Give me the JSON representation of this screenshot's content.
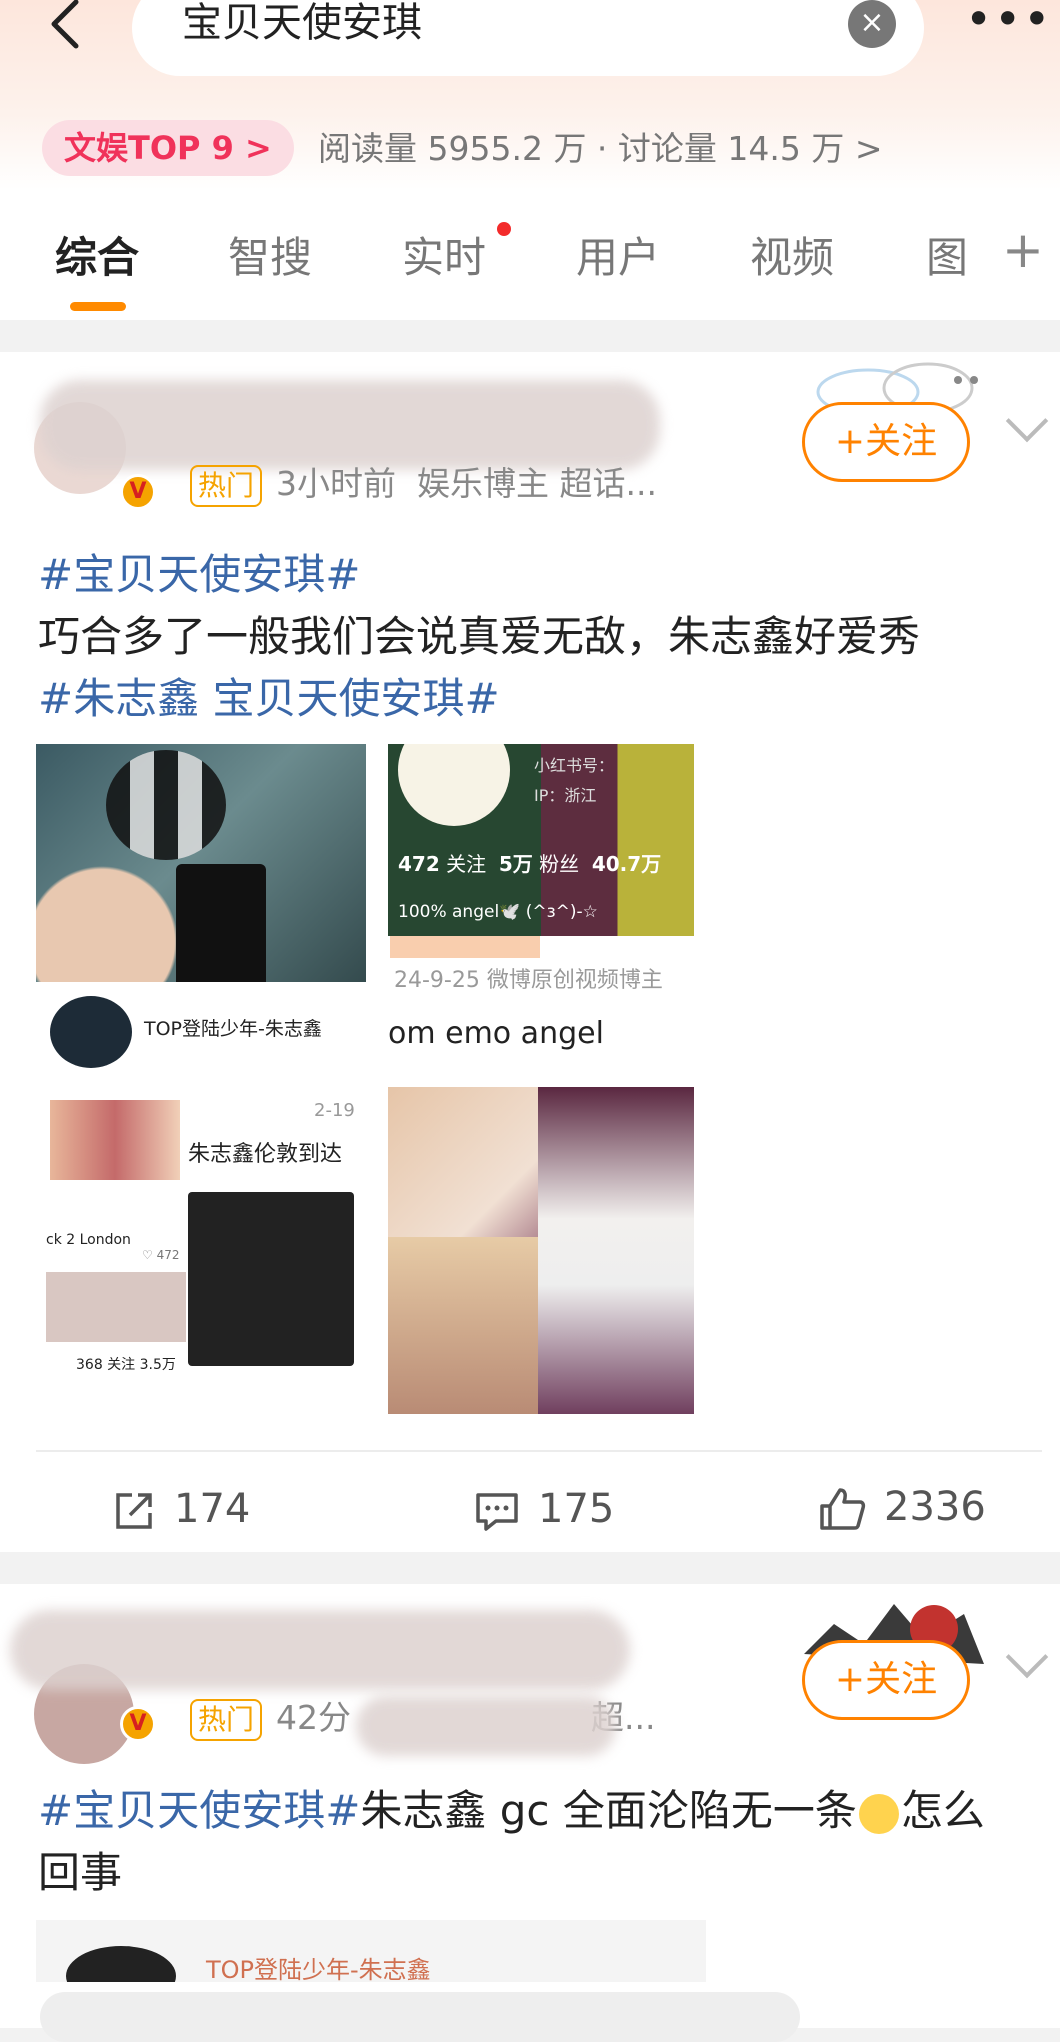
{
  "search": {
    "query": "宝贝天使安琪"
  },
  "topic": {
    "rank_badge": "文娱TOP 9 >",
    "stats": "阅读量 5955.2 万 · 讨论量 14.5 万 >"
  },
  "tabs": [
    {
      "label": "综合"
    },
    {
      "label": "智搜"
    },
    {
      "label": "实时"
    },
    {
      "label": "用户"
    },
    {
      "label": "视频"
    },
    {
      "label": "图"
    }
  ],
  "posts": [
    {
      "time": "3小时前",
      "source": "娱乐博主 超话...",
      "hot_label": "热门",
      "follow": "+关注",
      "tag1": "#宝贝天使安琪#",
      "text": "巧合多了一般我们会说真爱无敌，朱志鑫好爱秀",
      "tag2": "#朱志鑫 宝贝天使安琪#",
      "img1_caption": "TOP登陆少年-朱志鑫",
      "img2_stats": {
        "follow": "472",
        "follow_label": "关注",
        "fans": "5万",
        "fans_label": "粉丝",
        "likes": "40.7万"
      },
      "img2_xhs": "小红书号：",
      "img2_ip": "IP：浙江",
      "img2_bio": "100% angel🕊️ (^з^)-☆",
      "img2_date": "24-9-25  微博原创视频博主",
      "img2_line": "om emo angel",
      "img3_date": "2-19",
      "img3_title": "朱志鑫伦敦到达",
      "img3_sub": "ck 2 London",
      "img3_nums": "368 关注  3.5万",
      "img3_likes": "♡ 472",
      "shares": "174",
      "comments": "175",
      "likes": "2336"
    },
    {
      "time": "42分",
      "source": "超...",
      "hot_label": "热门",
      "follow": "+关注",
      "tag1": "#宝贝天使安琪#",
      "text_a": "朱志鑫 gc 全面沦陷无一条",
      "text_b": "怎么",
      "text_c": "回事",
      "preview_caption": "TOP登陆少年-朱志鑫"
    }
  ],
  "colors": {
    "accent": "#ff8200",
    "tag": "#3a67a8",
    "badge_text": "#f0325a"
  }
}
